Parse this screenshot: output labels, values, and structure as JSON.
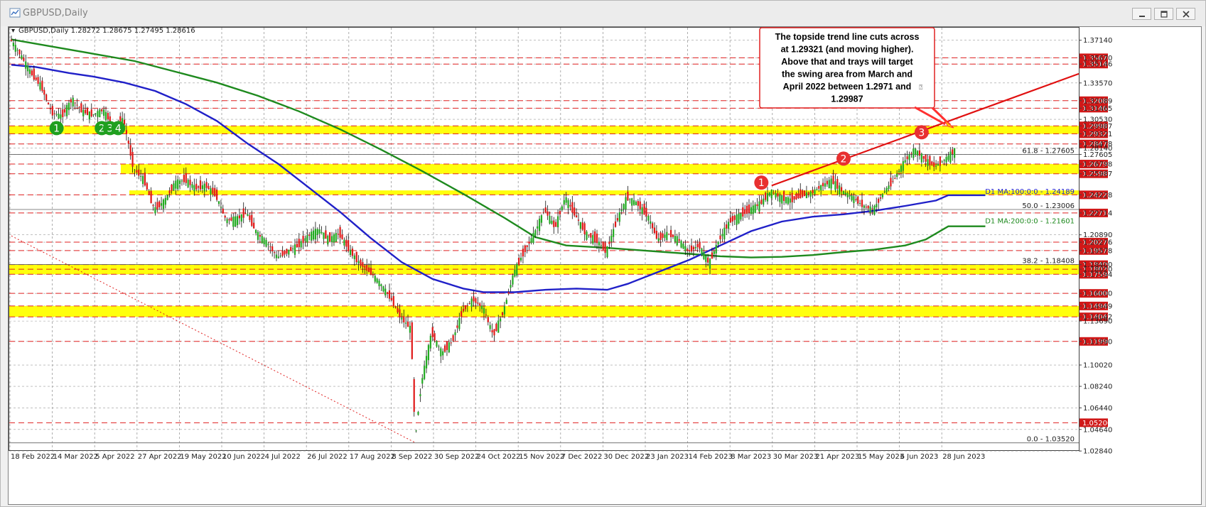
{
  "window": {
    "title": "GBPUSD,Daily"
  },
  "chart_data": {
    "type": "candlestick",
    "symbol_info": {
      "symbol": "GBPUSD,Daily",
      "open": "1.28272",
      "high": "1.28675",
      "low": "1.27495",
      "close": "1.28616"
    },
    "y_range": [
      1.2767,
      1.3765
    ],
    "y_ticks": [
      "1.37140",
      "1.35670",
      "1.35146",
      "1.33570",
      "1.32089",
      "1.31465",
      "1.30530",
      "1.29987",
      "1.29321",
      "1.28478",
      "1.28140",
      "1.27605",
      "1.26798",
      "1.25987",
      "1.24228",
      "1.22714",
      "1.20890",
      "1.20276",
      "1.19578",
      "1.18400",
      "1.18020",
      "1.17594",
      "1.16000",
      "1.14949",
      "1.14042",
      "1.13690",
      "1.11990",
      "1.10020",
      "1.08240",
      "1.06440",
      "1.04640",
      "1.02840"
    ],
    "x_ticks": [
      "18 Feb 2022",
      "14 Mar 2022",
      "5 Apr 2022",
      "27 Apr 2022",
      "19 May 2022",
      "10 Jun 2022",
      "4 Jul 2022",
      "26 Jul 2022",
      "17 Aug 2022",
      "8 Sep 2022",
      "30 Sep 2022",
      "24 Oct 2022",
      "15 Nov 2022",
      "7 Dec 2022",
      "30 Dec 2022",
      "23 Jan 2023",
      "14 Feb 2023",
      "8 Mar 2023",
      "30 Mar 2023",
      "21 Apr 2023",
      "15 May 2023",
      "6 Jun 2023",
      "28 Jun 2023"
    ],
    "price_line_labels": [
      {
        "value": 1.3567,
        "label": "1.35670"
      },
      {
        "value": 1.35146,
        "label": "1.35146"
      },
      {
        "value": 1.32089,
        "label": "1.32089"
      },
      {
        "value": 1.31465,
        "label": "1.31465"
      },
      {
        "value": 1.29987,
        "label": "1.29987"
      },
      {
        "value": 1.29321,
        "label": "1.29321"
      },
      {
        "value": 1.28478,
        "label": "1.28478"
      },
      {
        "value": 1.26798,
        "label": "1.26798"
      },
      {
        "value": 1.25987,
        "label": "1.25987"
      },
      {
        "value": 1.24228,
        "label": "1.24228"
      },
      {
        "value": 1.22714,
        "label": "1.22714"
      },
      {
        "value": 1.20276,
        "label": "1.20276"
      },
      {
        "value": 1.19578,
        "label": "1.19578"
      },
      {
        "value": 1.184,
        "label": "1.18400"
      },
      {
        "value": 1.1802,
        "label": "1.18020"
      },
      {
        "value": 1.17594,
        "label": "1.17594"
      },
      {
        "value": 1.16,
        "label": "1.16000"
      },
      {
        "value": 1.14949,
        "label": "1.14949"
      },
      {
        "value": 1.14042,
        "label": "1.14042"
      },
      {
        "value": 1.1199,
        "label": "1.11990"
      },
      {
        "value": 1.052,
        "label": "1.05200"
      }
    ],
    "yellow_zones": [
      {
        "from": 1.29321,
        "to": 1.29987
      },
      {
        "from": 1.25987,
        "to": 1.26798
      },
      {
        "from": 1.24228,
        "to": 1.246
      },
      {
        "from": 1.17594,
        "to": 1.184
      },
      {
        "from": 1.14042,
        "to": 1.14949
      }
    ],
    "fib_labels": [
      {
        "value": 1.27605,
        "label": "61.8 - 1.27605"
      },
      {
        "value": 1.23006,
        "label": "50.0 - 1.23006"
      },
      {
        "value": 1.18408,
        "label": "38.2 - 1.18408"
      },
      {
        "value": 1.0352,
        "label": "0.0 - 1.03520"
      }
    ],
    "ma_labels": {
      "ma100": "D1 MA:100:0:0 - 1.24189",
      "ma200": "D1 MA:200:0:0 - 1.21601"
    },
    "ma100_path": [
      [
        0,
        1.3508
      ],
      [
        12,
        1.349
      ],
      [
        28,
        1.344
      ],
      [
        40,
        1.341
      ],
      [
        55,
        1.336
      ],
      [
        70,
        1.329
      ],
      [
        85,
        1.318
      ],
      [
        100,
        1.304
      ],
      [
        115,
        1.285
      ],
      [
        130,
        1.268
      ],
      [
        145,
        1.248
      ],
      [
        160,
        1.228
      ],
      [
        175,
        1.206
      ],
      [
        190,
        1.186
      ],
      [
        205,
        1.172
      ],
      [
        220,
        1.164
      ],
      [
        230,
        1.161
      ],
      [
        245,
        1.161
      ],
      [
        260,
        1.163
      ],
      [
        275,
        1.164
      ],
      [
        290,
        1.163
      ],
      [
        300,
        1.168
      ],
      [
        315,
        1.178
      ],
      [
        330,
        1.188
      ],
      [
        345,
        1.2
      ],
      [
        360,
        1.212
      ],
      [
        375,
        1.22
      ],
      [
        390,
        1.224
      ],
      [
        405,
        1.226
      ],
      [
        420,
        1.229
      ],
      [
        435,
        1.233
      ],
      [
        450,
        1.2375
      ],
      [
        456,
        1.242
      ],
      [
        474,
        1.242
      ]
    ],
    "ma200_path": [
      [
        0,
        1.372
      ],
      [
        20,
        1.366
      ],
      [
        40,
        1.36
      ],
      [
        60,
        1.354
      ],
      [
        80,
        1.345
      ],
      [
        100,
        1.336
      ],
      [
        120,
        1.325
      ],
      [
        140,
        1.312
      ],
      [
        160,
        1.297
      ],
      [
        180,
        1.28
      ],
      [
        200,
        1.262
      ],
      [
        220,
        1.243
      ],
      [
        240,
        1.223
      ],
      [
        255,
        1.207
      ],
      [
        270,
        1.2
      ],
      [
        290,
        1.198
      ],
      [
        310,
        1.1955
      ],
      [
        330,
        1.193
      ],
      [
        345,
        1.191
      ],
      [
        360,
        1.19
      ],
      [
        375,
        1.1905
      ],
      [
        390,
        1.192
      ],
      [
        405,
        1.1945
      ],
      [
        420,
        1.1965
      ],
      [
        435,
        1.2
      ],
      [
        445,
        1.205
      ],
      [
        456,
        1.216
      ],
      [
        474,
        1.216
      ]
    ],
    "trend_line": {
      "from": [
        370,
        1.25
      ],
      "to": [
        474,
        1.309
      ]
    },
    "downtrend_line": {
      "from": [
        0,
        1.208
      ],
      "to": [
        197,
        1.035
      ]
    },
    "price_path": [
      [
        0,
        1.372
      ],
      [
        5,
        1.359
      ],
      [
        10,
        1.344
      ],
      [
        15,
        1.333
      ],
      [
        20,
        1.311
      ],
      [
        25,
        1.308
      ],
      [
        30,
        1.322
      ],
      [
        35,
        1.312
      ],
      [
        40,
        1.309
      ],
      [
        45,
        1.313
      ],
      [
        50,
        1.3
      ],
      [
        55,
        1.305
      ],
      [
        60,
        1.264
      ],
      [
        65,
        1.255
      ],
      [
        70,
        1.23
      ],
      [
        75,
        1.237
      ],
      [
        80,
        1.252
      ],
      [
        85,
        1.255
      ],
      [
        90,
        1.248
      ],
      [
        95,
        1.25
      ],
      [
        100,
        1.242
      ],
      [
        105,
        1.221
      ],
      [
        110,
        1.222
      ],
      [
        115,
        1.227
      ],
      [
        120,
        1.21
      ],
      [
        125,
        1.202
      ],
      [
        130,
        1.19
      ],
      [
        135,
        1.195
      ],
      [
        140,
        1.2
      ],
      [
        145,
        1.208
      ],
      [
        150,
        1.213
      ],
      [
        155,
        1.205
      ],
      [
        160,
        1.21
      ],
      [
        165,
        1.196
      ],
      [
        170,
        1.185
      ],
      [
        175,
        1.178
      ],
      [
        180,
        1.168
      ],
      [
        185,
        1.156
      ],
      [
        190,
        1.14
      ],
      [
        195,
        1.13
      ],
      [
        197,
        1.04
      ],
      [
        200,
        1.085
      ],
      [
        205,
        1.127
      ],
      [
        210,
        1.11
      ],
      [
        215,
        1.12
      ],
      [
        220,
        1.145
      ],
      [
        225,
        1.155
      ],
      [
        230,
        1.148
      ],
      [
        235,
        1.125
      ],
      [
        240,
        1.145
      ],
      [
        245,
        1.177
      ],
      [
        250,
        1.195
      ],
      [
        255,
        1.21
      ],
      [
        260,
        1.23
      ],
      [
        265,
        1.215
      ],
      [
        270,
        1.24
      ],
      [
        275,
        1.225
      ],
      [
        280,
        1.21
      ],
      [
        285,
        1.205
      ],
      [
        290,
        1.195
      ],
      [
        295,
        1.22
      ],
      [
        300,
        1.24
      ],
      [
        305,
        1.235
      ],
      [
        310,
        1.225
      ],
      [
        315,
        1.205
      ],
      [
        320,
        1.21
      ],
      [
        325,
        1.205
      ],
      [
        330,
        1.195
      ],
      [
        335,
        1.2
      ],
      [
        340,
        1.185
      ],
      [
        345,
        1.205
      ],
      [
        350,
        1.22
      ],
      [
        355,
        1.225
      ],
      [
        360,
        1.23
      ],
      [
        365,
        1.235
      ],
      [
        370,
        1.245
      ],
      [
        375,
        1.24
      ],
      [
        380,
        1.238
      ],
      [
        385,
        1.242
      ],
      [
        390,
        1.244
      ],
      [
        395,
        1.25
      ],
      [
        400,
        1.254
      ],
      [
        405,
        1.245
      ],
      [
        410,
        1.24
      ],
      [
        415,
        1.233
      ],
      [
        420,
        1.23
      ],
      [
        425,
        1.244
      ],
      [
        430,
        1.255
      ],
      [
        435,
        1.27
      ],
      [
        440,
        1.28
      ],
      [
        445,
        1.272
      ],
      [
        450,
        1.266
      ],
      [
        455,
        1.272
      ],
      [
        460,
        1.28
      ]
    ],
    "markers": [
      {
        "label": "1",
        "color": "green",
        "x": 22,
        "y": 1.298
      },
      {
        "label": "2",
        "color": "green",
        "x": 44,
        "y": 1.298
      },
      {
        "label": "3",
        "color": "green",
        "x": 48,
        "y": 1.298
      },
      {
        "label": "4",
        "color": "green",
        "x": 52,
        "y": 1.298
      },
      {
        "label": "1",
        "color": "red",
        "x": 365,
        "y": 1.2525
      },
      {
        "label": "2",
        "color": "red",
        "x": 405,
        "y": 1.2725
      },
      {
        "label": "3",
        "color": "red",
        "x": 443,
        "y": 1.2945
      }
    ],
    "annotation": {
      "lines": [
        "The topside trend line cuts across",
        "at 1.29321 (and moving higher).",
        "Above that and trays will target",
        "the swing area from March and",
        "April 2022 between 1.2971 and",
        "1.29987"
      ],
      "glyph": "⍰"
    }
  }
}
